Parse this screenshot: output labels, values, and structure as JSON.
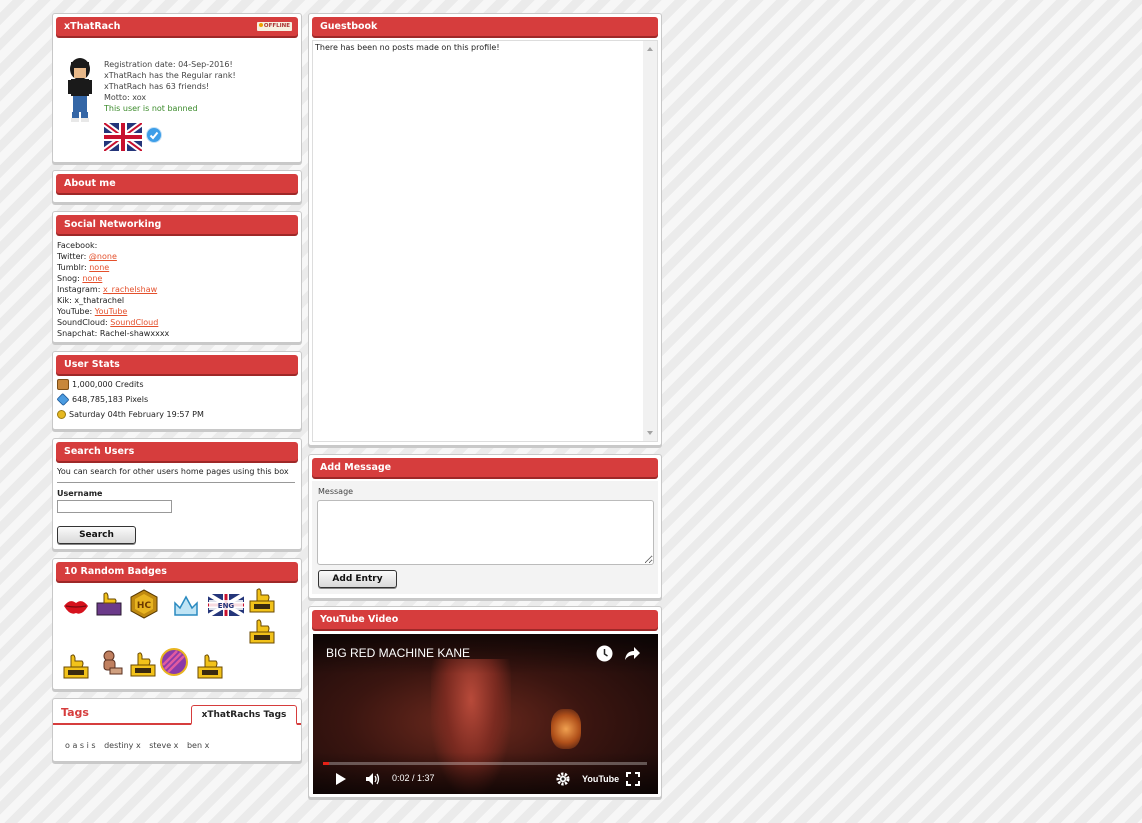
{
  "profile": {
    "username": "xThatRach",
    "status_label": "OFFLINE",
    "registration": "Registration date: 04-Sep-2016!",
    "rank": "xThatRach has the Regular rank!",
    "friends": "xThatRach has 63 friends!",
    "motto": "Motto: xox",
    "ban_status": "This user is not banned",
    "colors": {
      "banned_status": "#3a8a2a",
      "verified": "#3d9ee8"
    }
  },
  "about": {
    "title": "About me"
  },
  "social": {
    "title": "Social Networking",
    "items": [
      {
        "label": "Facebook:",
        "value": ""
      },
      {
        "label": "Twitter: ",
        "value": "@none"
      },
      {
        "label": "Tumblr: ",
        "value": "none"
      },
      {
        "label": "Snog: ",
        "value": "none"
      },
      {
        "label": "Instagram: ",
        "value": "x_rachelshaw"
      },
      {
        "label": "Kik: x_thatrachel",
        "value": ""
      },
      {
        "label": "YouTube: ",
        "value": "YouTube"
      },
      {
        "label": "SoundCloud: ",
        "value": "SoundCloud"
      },
      {
        "label": "Snapchat: Rachel-shawxxxx",
        "value": ""
      }
    ]
  },
  "stats": {
    "title": "User Stats",
    "credits": "1,000,000 Credits",
    "pixels": "648,785,183 Pixels",
    "last_online": "Saturday 04th February 19:57 PM",
    "icons": [
      "credits-icon",
      "pixels-icon",
      "key-icon"
    ]
  },
  "search": {
    "title": "Search Users",
    "description": "You can search for other users home pages using this box",
    "label": "Username",
    "value": "",
    "button": "Search"
  },
  "badges": {
    "title": "10 Random Badges",
    "items": [
      "lips-badge",
      "thumbs-up-badge",
      "hc-badge",
      "crown-badge",
      "eng-flag-badge",
      "thumbs-up-badge",
      "thumbs-up-badge",
      "thumbs-up-badge",
      "teddy-badge",
      "thumbs-up-badge",
      "striped-coin-badge",
      "thumbs-up-badge"
    ]
  },
  "tags": {
    "title": "Tags",
    "tab": "xThatRachs Tags",
    "items": [
      "o a s i s",
      "destiny x",
      "steve x",
      "ben x"
    ]
  },
  "guestbook": {
    "title": "Guestbook",
    "empty": "There has been no posts made on this profile!"
  },
  "add_message": {
    "title": "Add Message",
    "label": "Message",
    "value": "",
    "button": "Add Entry"
  },
  "video": {
    "panel_title": "YouTube Video",
    "title": "BIG RED MACHINE KANE",
    "time": "0:02 / 1:37",
    "logo": "YouTube",
    "progress": 0.02
  }
}
